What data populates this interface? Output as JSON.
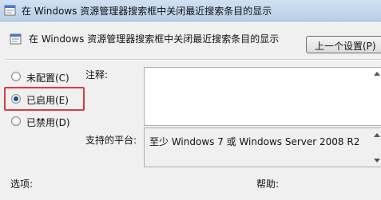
{
  "window": {
    "title": "在 Windows 资源管理器搜索框中关闭最近搜索条目的显示"
  },
  "policy": {
    "title": "在 Windows 资源管理器搜索框中关闭最近搜索条目的显示",
    "prev_setting_label": "上一个设置(P)"
  },
  "state": {
    "options": [
      {
        "label": "未配置(C)",
        "checked": false
      },
      {
        "label": "已启用(E)",
        "checked": true
      },
      {
        "label": "已禁用(D)",
        "checked": false
      }
    ]
  },
  "comment": {
    "label": "注释:",
    "value": ""
  },
  "platform": {
    "label": "支持的平台:",
    "value": "至少 Windows 7 或 Windows Server 2008 R2"
  },
  "sections": {
    "options_label": "选项:",
    "help_label": "帮助:"
  },
  "colors": {
    "highlight": "#e0393e",
    "titlebar": "#b9cfe8"
  },
  "icons": {
    "window": "policy-settings-icon",
    "header": "policy-settings-icon"
  }
}
